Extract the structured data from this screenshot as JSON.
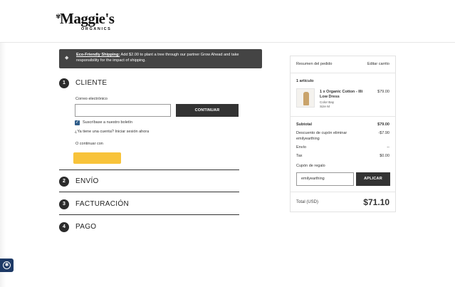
{
  "header": {
    "logo_text": "Maggie's",
    "logo_subtext": "ORGANICS"
  },
  "banner": {
    "icon": "tag-icon",
    "headline": "Eco-Friendly Shipping:",
    "text": " Add $2.00 to plant a tree through our partner Grow Ahead and take responsibility for the impact of shipping."
  },
  "steps": [
    {
      "number": "1",
      "title": "CLIENTE"
    },
    {
      "number": "2",
      "title": "ENVÍO"
    },
    {
      "number": "3",
      "title": "FACTURACIÓN"
    },
    {
      "number": "4",
      "title": "PAGO"
    }
  ],
  "customer": {
    "email_label": "Correo electrónico",
    "email_value": "",
    "continue_label": "CONTINUAR",
    "newsletter_label": "Suscríbase a nuestro boletín",
    "newsletter_checked": true,
    "login_prompt": "¿Ya tiene una cuenta? Iniciar sesión ahora",
    "or_continue": "O continuar con"
  },
  "summary": {
    "title": "Resumen del pedido",
    "edit_cart": "Editar carrito",
    "item_count": "1 artículo",
    "item": {
      "name": "1 x Organic Cotton - Illi Low Dress",
      "color": "Color Bay",
      "size": "Size M",
      "price": "$79.00"
    },
    "subtotal_label": "Subtotal",
    "subtotal_value": "$79.00",
    "discount_label": "Descuento de cupón eliminar",
    "discount_code": "emilyearthing",
    "discount_value": "-$7.90",
    "shipping_label": "Envío",
    "shipping_value": "--",
    "tax_label": "Tax",
    "tax_value": "$0.00",
    "gift_label": "Cupón de regalo",
    "gift_input_value": "emilyearthing",
    "apply_label": "APLICAR",
    "total_label": "Total (USD)",
    "total_value": "$71.10"
  },
  "colors": {
    "banner_bg": "#444444",
    "button_dark": "#333333",
    "paypal_yellow": "#f8c33a",
    "accessibility_blue": "#1e3a66",
    "checkbox_blue": "#2f5d8a"
  }
}
